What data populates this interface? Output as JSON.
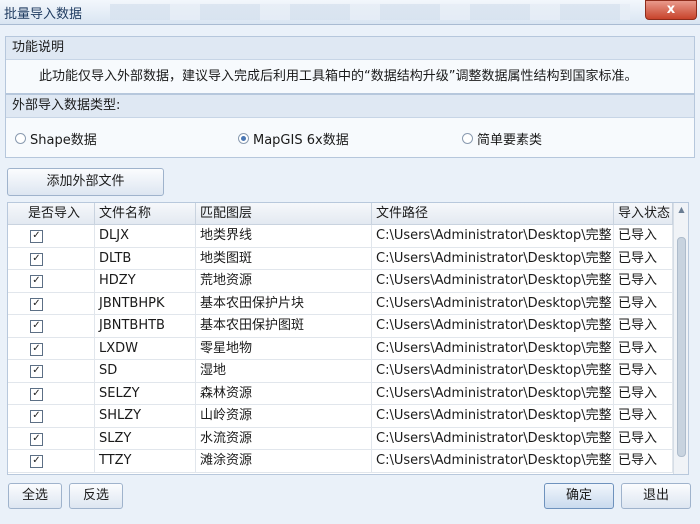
{
  "window": {
    "title": "批量导入数据",
    "close_label": "x"
  },
  "description": {
    "header": "功能说明",
    "text": "此功能仅导入外部数据，建议导入完成后利用工具箱中的“数据结构升级”调整数据属性结构到国家标准。"
  },
  "import_type": {
    "header": "外部导入数据类型:",
    "options": [
      {
        "label": "Shape数据",
        "selected": false
      },
      {
        "label": "MapGIS 6x数据",
        "selected": true
      },
      {
        "label": "简单要素类",
        "selected": false
      }
    ]
  },
  "add_button": "添加外部文件",
  "table": {
    "columns": [
      "是否导入",
      "文件名称",
      "匹配图层",
      "文件路径",
      "导入状态"
    ],
    "rows": [
      {
        "checked": true,
        "name": "DLJX",
        "layer": "地类界线",
        "path": "C:\\Users\\Administrator\\Desktop\\完整...",
        "status": "已导入"
      },
      {
        "checked": true,
        "name": "DLTB",
        "layer": "地类图斑",
        "path": "C:\\Users\\Administrator\\Desktop\\完整...",
        "status": "已导入"
      },
      {
        "checked": true,
        "name": "HDZY",
        "layer": "荒地资源",
        "path": "C:\\Users\\Administrator\\Desktop\\完整...",
        "status": "已导入"
      },
      {
        "checked": true,
        "name": "JBNTBHPK",
        "layer": "基本农田保护片块",
        "path": "C:\\Users\\Administrator\\Desktop\\完整...",
        "status": "已导入"
      },
      {
        "checked": true,
        "name": "JBNTBHTB",
        "layer": "基本农田保护图斑",
        "path": "C:\\Users\\Administrator\\Desktop\\完整...",
        "status": "已导入"
      },
      {
        "checked": true,
        "name": "LXDW",
        "layer": "零星地物",
        "path": "C:\\Users\\Administrator\\Desktop\\完整...",
        "status": "已导入"
      },
      {
        "checked": true,
        "name": "SD",
        "layer": "湿地",
        "path": "C:\\Users\\Administrator\\Desktop\\完整...",
        "status": "已导入"
      },
      {
        "checked": true,
        "name": "SELZY",
        "layer": "森林资源",
        "path": "C:\\Users\\Administrator\\Desktop\\完整...",
        "status": "已导入"
      },
      {
        "checked": true,
        "name": "SHLZY",
        "layer": "山岭资源",
        "path": "C:\\Users\\Administrator\\Desktop\\完整...",
        "status": "已导入"
      },
      {
        "checked": true,
        "name": "SLZY",
        "layer": "水流资源",
        "path": "C:\\Users\\Administrator\\Desktop\\完整...",
        "status": "已导入"
      },
      {
        "checked": true,
        "name": "TTZY",
        "layer": "滩涂资源",
        "path": "C:\\Users\\Administrator\\Desktop\\完整...",
        "status": "已导入"
      }
    ]
  },
  "footer": {
    "select_all": "全选",
    "invert": "反选",
    "ok": "确定",
    "exit": "退出"
  },
  "colors": {
    "window_bg": "#eaf1f9",
    "close_button": "#c7432b",
    "accent": "#4a77b4"
  }
}
